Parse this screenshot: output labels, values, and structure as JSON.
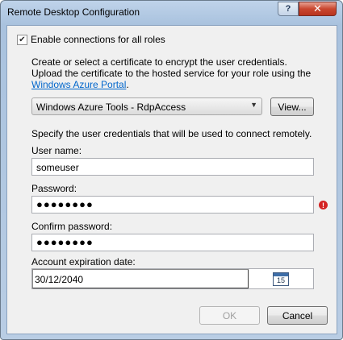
{
  "window": {
    "title": "Remote Desktop Configuration",
    "help_label": "?",
    "close_label": "✕"
  },
  "enable": {
    "checked": true,
    "check_mark": "✔",
    "label": "Enable connections for all roles"
  },
  "certificate": {
    "description_line1": "Create or select a certificate to encrypt the user credentials.",
    "description_line2": "Upload the certificate to the hosted service for your role using the",
    "portal_link": "Windows Azure Portal",
    "period": ".",
    "selected": "Windows Azure Tools - RdpAccess",
    "view_button": "View..."
  },
  "credentials": {
    "intro": "Specify the user credentials that will be used to connect remotely.",
    "username_label": "User name:",
    "username_value": "someuser",
    "password_label": "Password:",
    "password_value": "●●●●●●●●",
    "password_error_icon": "!",
    "confirm_label": "Confirm password:",
    "confirm_value": "●●●●●●●●",
    "expiration_label": "Account expiration date:",
    "expiration_value": "30/12/2040",
    "calendar_day": "15"
  },
  "footer": {
    "ok_label": "OK",
    "ok_enabled": false,
    "cancel_label": "Cancel"
  }
}
